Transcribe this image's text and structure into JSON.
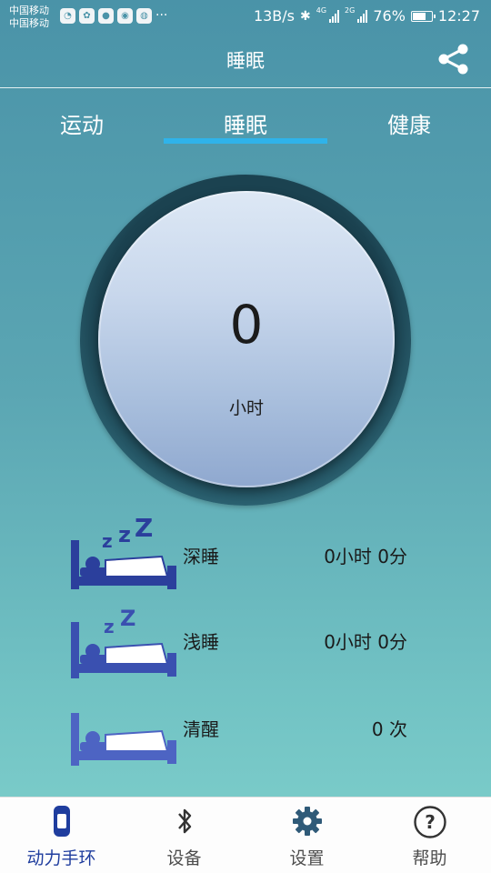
{
  "status_bar": {
    "carrier_1": "中国移动",
    "carrier_2": "中国移动",
    "notification_icons": [
      "wifi-icon",
      "app-icon",
      "location-icon",
      "app-icon",
      "wechat-icon"
    ],
    "more": "···",
    "net_speed": "13B/s",
    "sig_tag_1": "4G",
    "sig_tag_2": "2G",
    "battery": "76%",
    "battery_level": 0.76,
    "time": "12:27"
  },
  "header": {
    "title": "睡眠",
    "share_icon": "share-icon"
  },
  "tabs": {
    "items": [
      {
        "label": "运动"
      },
      {
        "label": "睡眠"
      },
      {
        "label": "健康"
      }
    ],
    "active_index": 1
  },
  "dial": {
    "value": "0",
    "unit": "小时"
  },
  "sleep_rows": [
    {
      "icon": "deep-sleep-icon",
      "label": "深睡",
      "value": "0小时 0分"
    },
    {
      "icon": "light-sleep-icon",
      "label": "浅睡",
      "value": "0小时 0分"
    },
    {
      "icon": "awake-icon",
      "label": "清醒",
      "value": "0 次"
    }
  ],
  "bottom_nav": {
    "items": [
      {
        "icon": "band-icon",
        "label": "动力手环"
      },
      {
        "icon": "bluetooth-icon",
        "label": "设备"
      },
      {
        "icon": "gear-icon",
        "label": "设置"
      },
      {
        "icon": "help-icon",
        "label": "帮助"
      }
    ],
    "active_index": 0
  },
  "colors": {
    "accent": "#2fb3ea",
    "nav_active": "#1f3d9e",
    "bed_icon": "#2b3f9c"
  }
}
